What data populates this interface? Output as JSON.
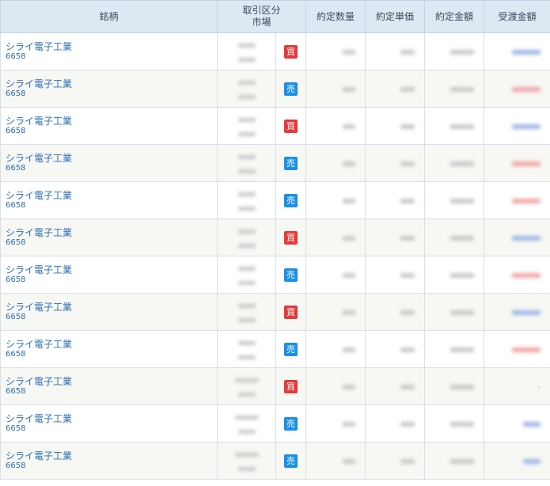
{
  "headers": {
    "stock": "銘柄",
    "trade_type_line1": "取引区分",
    "trade_type_line2": "市場",
    "qty": "約定数量",
    "unit_price": "約定単価",
    "amount": "約定金額",
    "settlement": "受渡金額"
  },
  "side_labels": {
    "buy": "買",
    "sell": "売"
  },
  "colors": {
    "buy": "#e23a3a",
    "sell": "#1a8fe6",
    "header_bg": "#dde8f3",
    "link": "#2a6fb3"
  },
  "rows": [
    {
      "name": "シライ電子工業",
      "code": "6658",
      "side": "買",
      "side_type": "buy",
      "settlement_type": "blue"
    },
    {
      "name": "シライ電子工業",
      "code": "6658",
      "side": "売",
      "side_type": "sell",
      "settlement_type": "red"
    },
    {
      "name": "シライ電子工業",
      "code": "6658",
      "side": "買",
      "side_type": "buy",
      "settlement_type": "blue"
    },
    {
      "name": "シライ電子工業",
      "code": "6658",
      "side": "売",
      "side_type": "sell",
      "settlement_type": "red"
    },
    {
      "name": "シライ電子工業",
      "code": "6658",
      "side": "売",
      "side_type": "sell",
      "settlement_type": "red"
    },
    {
      "name": "シライ電子工業",
      "code": "6658",
      "side": "買",
      "side_type": "buy",
      "settlement_type": "blue"
    },
    {
      "name": "シライ電子工業",
      "code": "6658",
      "side": "売",
      "side_type": "sell",
      "settlement_type": "red"
    },
    {
      "name": "シライ電子工業",
      "code": "6658",
      "side": "買",
      "side_type": "buy",
      "settlement_type": "blue"
    },
    {
      "name": "シライ電子工業",
      "code": "6658",
      "side": "売",
      "side_type": "sell",
      "settlement_type": "red"
    },
    {
      "name": "シライ電子工業",
      "code": "6658",
      "side": "買",
      "side_type": "buy",
      "settlement_type": "dash"
    },
    {
      "name": "シライ電子工業",
      "code": "6658",
      "side": "売",
      "side_type": "sell",
      "settlement_type": "blue"
    },
    {
      "name": "シライ電子工業",
      "code": "6658",
      "side": "売",
      "side_type": "sell",
      "settlement_type": "blue"
    }
  ]
}
